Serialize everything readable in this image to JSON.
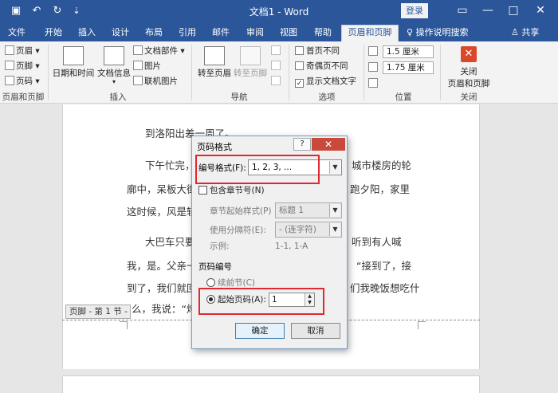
{
  "window": {
    "title": "文档1 - Word",
    "login": "登录",
    "minimize": "—",
    "maximize": "□",
    "close": "✕"
  },
  "quick_access": {
    "save": "▣",
    "undo": "↶",
    "redo": "↻",
    "customize": "⇣"
  },
  "tabs": [
    "文件",
    "开始",
    "插入",
    "设计",
    "布局",
    "引用",
    "邮件",
    "审阅",
    "视图",
    "帮助",
    "页眉和页脚"
  ],
  "tell_me": "♀ 操作说明搜索",
  "share": "♙ 共享",
  "ribbon": {
    "header_footer_group": {
      "items": [
        "页眉 ▾",
        "页脚 ▾",
        "页码 ▾"
      ],
      "label": "页眉和页脚"
    },
    "insert_group": {
      "datetime": "日期和时间",
      "docinfo": "文档信息",
      "docinfo_arrow": "▾",
      "parts": "文档部件 ▾",
      "picture": "图片",
      "online_picture": "联机图片",
      "label": "插入"
    },
    "nav_group": {
      "goto_header": "转至页眉",
      "goto_footer": "转至页脚",
      "label": "导航"
    },
    "options_group": {
      "first_page": "首页不同",
      "odd_even": "奇偶页不同",
      "show_text": "显示文档文字",
      "show_text_checked": "✓",
      "label": "选项"
    },
    "position_group": {
      "header_pos": "1.5 厘米",
      "footer_pos": "1.75 厘米",
      "label": "位置"
    },
    "close_group": {
      "close_line1": "关闭",
      "close_line2": "页眉和页脚",
      "label": "关闭"
    }
  },
  "document": {
    "lines": [
      "到洛阳出差一周了。",
      "下午忙完，",
      "城市楼房的轮",
      "廓中，呆板大街",
      "跑夕阳，家里",
      "这时候，风是轻",
      "大巴车只要",
      "听到有人喊",
      "我，是。父亲一",
      "“接到了，接",
      "到了，我们就回",
      "们我晚饭想吃什",
      "么，我说：“炖"
    ],
    "footer_tag": "页脚 - 第 1 节 -"
  },
  "dialog": {
    "title": "页码格式",
    "help": "?",
    "close": "✕",
    "number_format_label": "编号格式(F):",
    "number_format_value": "1, 2, 3, ...",
    "include_chapter": "包含章节号(N)",
    "chapter_style_label": "章节起始样式(P)",
    "chapter_style_value": "标题 1",
    "separator_label": "使用分隔符(E):",
    "separator_value": "-  (连字符)",
    "example_label": "示例:",
    "example_value": "1-1, 1-A",
    "page_numbering": "页码编号",
    "continue_prev": "续前节(C)",
    "start_at": "起始页码(A):",
    "start_value": "1",
    "ok": "确定",
    "cancel": "取消",
    "arrow_down": "▼",
    "spin_up": "▲",
    "spin_down": "▼"
  }
}
